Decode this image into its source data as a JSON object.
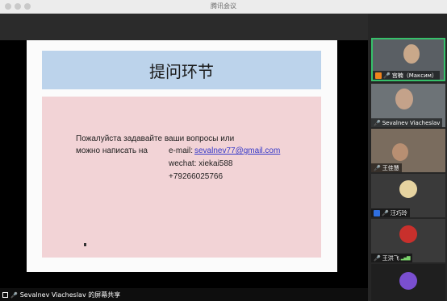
{
  "window": {
    "title": "腾讯会议"
  },
  "slide": {
    "title": "提问环节",
    "line1": "Пожалуйста задавайте ваши вопросы или",
    "line2": "можно написать на",
    "email_label": "e-mail:",
    "email": "sevalnev77@gmail.com",
    "wechat": "wechat: xiekai588",
    "phone": "+79266025766"
  },
  "participants": [
    {
      "name": "宫楠（Максим）",
      "status": "active-speaker"
    },
    {
      "name": "Sevalnev Viacheslav",
      "status": "video"
    },
    {
      "name": "王佳慧",
      "status": "video"
    },
    {
      "name": "汪巧玲",
      "status": "avatar"
    },
    {
      "name": "王洪飞",
      "status": "avatar"
    }
  ],
  "share": {
    "label": "Sevalnev Viacheslav 的屏幕共享"
  },
  "colors": {
    "active_border": "#36c06a",
    "slide_header": "#bcd3eb",
    "slide_body": "#f2d3d6",
    "link": "#3538c9"
  }
}
